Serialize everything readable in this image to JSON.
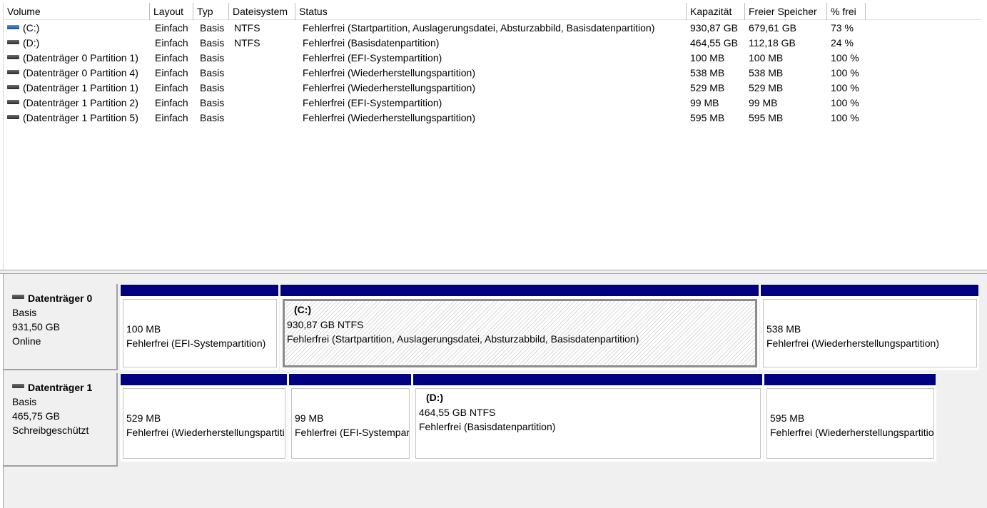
{
  "columns": [
    "Volume",
    "Layout",
    "Typ",
    "Dateisystem",
    "Status",
    "Kapazität",
    "Freier Speicher",
    "% frei"
  ],
  "volumes": [
    {
      "icon": "volume-blue-icon",
      "name": "(C:)",
      "layout": "Einfach",
      "type": "Basis",
      "fs": "NTFS",
      "status": "Fehlerfrei (Startpartition, Auslagerungsdatei, Absturzabbild, Basisdatenpartition)",
      "capacity": "930,87 GB",
      "free": "679,61 GB",
      "pct": "73 %"
    },
    {
      "icon": "volume-gray-icon",
      "name": "(D:)",
      "layout": "Einfach",
      "type": "Basis",
      "fs": "NTFS",
      "status": "Fehlerfrei (Basisdatenpartition)",
      "capacity": "464,55 GB",
      "free": "112,18 GB",
      "pct": "24 %"
    },
    {
      "icon": "volume-gray-icon",
      "name": "(Datenträger 0 Partition 1)",
      "layout": "Einfach",
      "type": "Basis",
      "fs": "",
      "status": "Fehlerfrei (EFI-Systempartition)",
      "capacity": "100 MB",
      "free": "100 MB",
      "pct": "100 %"
    },
    {
      "icon": "volume-gray-icon",
      "name": "(Datenträger 0 Partition 4)",
      "layout": "Einfach",
      "type": "Basis",
      "fs": "",
      "status": "Fehlerfrei (Wiederherstellungspartition)",
      "capacity": "538 MB",
      "free": "538 MB",
      "pct": "100 %"
    },
    {
      "icon": "volume-gray-icon",
      "name": "(Datenträger 1 Partition 1)",
      "layout": "Einfach",
      "type": "Basis",
      "fs": "",
      "status": "Fehlerfrei (Wiederherstellungspartition)",
      "capacity": "529 MB",
      "free": "529 MB",
      "pct": "100 %"
    },
    {
      "icon": "volume-gray-icon",
      "name": "(Datenträger 1 Partition 2)",
      "layout": "Einfach",
      "type": "Basis",
      "fs": "",
      "status": "Fehlerfrei (EFI-Systempartition)",
      "capacity": "99 MB",
      "free": "99 MB",
      "pct": "100 %"
    },
    {
      "icon": "volume-gray-icon",
      "name": "(Datenträger 1 Partition 5)",
      "layout": "Einfach",
      "type": "Basis",
      "fs": "",
      "status": "Fehlerfrei (Wiederherstellungspartition)",
      "capacity": "595 MB",
      "free": "595 MB",
      "pct": "100 %"
    }
  ],
  "disks": [
    {
      "icon": "disk-icon",
      "name": "Datenträger 0",
      "type": "Basis",
      "size": "931,50 GB",
      "state": "Online",
      "partitions": [
        {
          "title": "",
          "size": "100 MB",
          "status": "Fehlerfrei (EFI-Systempartition)",
          "selected": false
        },
        {
          "title": "(C:)",
          "size": "930,87 GB NTFS",
          "status": "Fehlerfrei (Startpartition, Auslagerungsdatei, Absturzabbild, Basisdatenpartition)",
          "selected": true
        },
        {
          "title": "",
          "size": "538 MB",
          "status": "Fehlerfrei (Wiederherstellungspartition)",
          "selected": false
        }
      ]
    },
    {
      "icon": "disk-icon",
      "name": "Datenträger 1",
      "type": "Basis",
      "size": "465,75 GB",
      "state": "Schreibgeschützt",
      "partitions": [
        {
          "title": "",
          "size": "529 MB",
          "status": "Fehlerfrei (Wiederherstellungspartition)",
          "selected": false
        },
        {
          "title": "",
          "size": "99 MB",
          "status": "Fehlerfrei (EFI-Systempartition)",
          "selected": false
        },
        {
          "title": "(D:)",
          "size": "464,55 GB NTFS",
          "status": "Fehlerfrei (Basisdatenpartition)",
          "selected": false
        },
        {
          "title": "",
          "size": "595 MB",
          "status": "Fehlerfrei (Wiederherstellungspartition)",
          "selected": false
        }
      ]
    }
  ]
}
